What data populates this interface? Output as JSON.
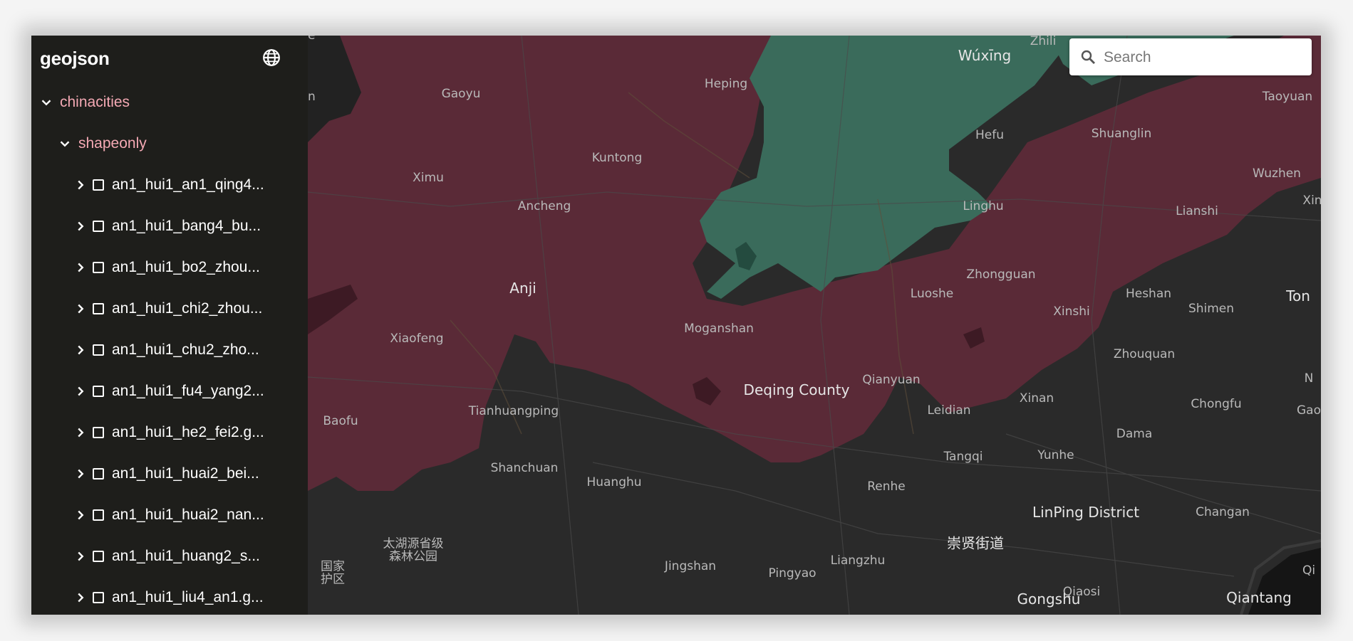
{
  "sidebar": {
    "title": "geojson",
    "tree": {
      "root": {
        "label": "chinacities"
      },
      "folder": {
        "label": "shapeonly"
      },
      "files": [
        "an1_hui1_an1_qing4...",
        "an1_hui1_bang4_bu...",
        "an1_hui1_bo2_zhou...",
        "an1_hui1_chi2_zhou...",
        "an1_hui1_chu2_zho...",
        "an1_hui1_fu4_yang2...",
        "an1_hui1_he2_fei2.g...",
        "an1_hui1_huai2_bei...",
        "an1_hui1_huai2_nan...",
        "an1_hui1_huang2_s...",
        "an1_hui1_liu4_an1.g..."
      ]
    }
  },
  "search": {
    "placeholder": "Search",
    "value": ""
  },
  "colors": {
    "sidebar_bg": "#1e1e1b",
    "tree_accent": "#f4a9b4",
    "map_bg": "#2a2a2a",
    "region_red": "#5a2a37",
    "region_green": "#3a6b5b"
  },
  "map": {
    "labels": [
      {
        "text": "Wúxīng",
        "big": true
      },
      {
        "text": "Zhili"
      },
      {
        "text": "Taoyuan"
      },
      {
        "text": "Gaoyu"
      },
      {
        "text": "Heping"
      },
      {
        "text": "Hefu"
      },
      {
        "text": "Shuanglin"
      },
      {
        "text": "Kuntong"
      },
      {
        "text": "Wuzhen"
      },
      {
        "text": "Ximu"
      },
      {
        "text": "Xin"
      },
      {
        "text": "Ancheng"
      },
      {
        "text": "Linghu"
      },
      {
        "text": "Lianshi"
      },
      {
        "text": "Zhongguan"
      },
      {
        "text": "Anji",
        "big": true
      },
      {
        "text": "Luoshe"
      },
      {
        "text": "Heshan"
      },
      {
        "text": "Shimen"
      },
      {
        "text": "Ton",
        "big": true
      },
      {
        "text": "Xinshi"
      },
      {
        "text": "Moganshan"
      },
      {
        "text": "Xiaofeng"
      },
      {
        "text": "Zhouquan"
      },
      {
        "text": "N"
      },
      {
        "text": "Qianyuan"
      },
      {
        "text": "Deqing County",
        "big": true
      },
      {
        "text": "Xinan"
      },
      {
        "text": "Chongfu"
      },
      {
        "text": "Gao"
      },
      {
        "text": "Leidian"
      },
      {
        "text": "Tianhuangping"
      },
      {
        "text": "Baofu"
      },
      {
        "text": "Dama"
      },
      {
        "text": "Tangqi"
      },
      {
        "text": "Yunhe"
      },
      {
        "text": "Shanchuan"
      },
      {
        "text": "Huanghu"
      },
      {
        "text": "Renhe"
      },
      {
        "text": "LinPing District",
        "big": true
      },
      {
        "text": "Changan"
      },
      {
        "text": "崇贤街道",
        "big": true
      },
      {
        "text": "太湖源省级"
      },
      {
        "text": "森林公园"
      },
      {
        "text": "Liangzhu"
      },
      {
        "text": "Jingshan"
      },
      {
        "text": "Pingyao"
      },
      {
        "text": "国家"
      },
      {
        "text": "护区"
      },
      {
        "text": "Qiaosi"
      },
      {
        "text": "Qi"
      },
      {
        "text": "Gongshu",
        "big": true
      },
      {
        "text": "Qiantang",
        "big": true
      },
      {
        "text": "e"
      },
      {
        "text": "n"
      }
    ]
  }
}
